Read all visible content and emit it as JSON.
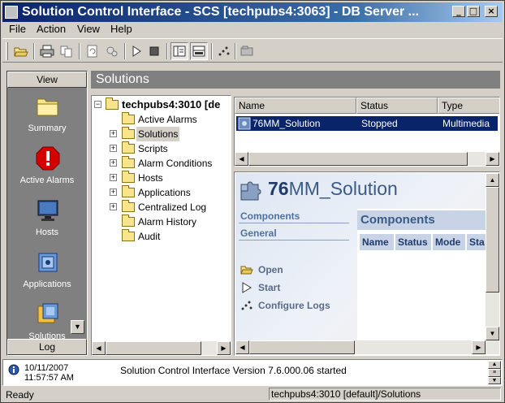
{
  "window": {
    "title": "Solution Control Interface - SCS [techpubs4:3063] - DB Server ...",
    "min_glyph": "_",
    "max_glyph": "□",
    "close_glyph": "×"
  },
  "menu": [
    "File",
    "Action",
    "View",
    "Help"
  ],
  "toolbar": {
    "icons": [
      "open-folder-icon",
      "print-icon",
      "copy-icon",
      "refresh-icon",
      "properties-icon",
      "start-icon",
      "stop-icon",
      "view-tree-icon",
      "view-details-icon",
      "configure-logs-icon",
      "database-icon"
    ]
  },
  "viewbar": {
    "header": "View",
    "footer": "Log",
    "items": [
      {
        "label": "Summary",
        "icon": "folder-icon"
      },
      {
        "label": "Active Alarms",
        "icon": "alarm-icon"
      },
      {
        "label": "Hosts",
        "icon": "monitor-icon"
      },
      {
        "label": "Applications",
        "icon": "application-icon"
      },
      {
        "label": "Solutions",
        "icon": "solution-icon"
      }
    ]
  },
  "section_title": "Solutions",
  "tree": {
    "root": "techpubs4:3010 [de",
    "items": [
      {
        "label": "Active Alarms",
        "expandable": false,
        "selected": false
      },
      {
        "label": "Solutions",
        "expandable": true,
        "selected": true
      },
      {
        "label": "Scripts",
        "expandable": true,
        "selected": false
      },
      {
        "label": "Alarm Conditions",
        "expandable": true,
        "selected": false
      },
      {
        "label": "Hosts",
        "expandable": true,
        "selected": false
      },
      {
        "label": "Applications",
        "expandable": true,
        "selected": false
      },
      {
        "label": "Centralized Log",
        "expandable": true,
        "selected": false
      },
      {
        "label": "Alarm History",
        "expandable": false,
        "selected": false
      },
      {
        "label": "Audit",
        "expandable": false,
        "selected": false
      }
    ]
  },
  "list": {
    "columns": [
      "Name",
      "Status",
      "Type"
    ],
    "rows": [
      {
        "name": "76MM_Solution",
        "status": "Stopped",
        "type": "Multimedia"
      }
    ]
  },
  "detail": {
    "title_prefix": "76",
    "title_rest": "MM_Solution",
    "links": [
      "Components",
      "General"
    ],
    "components_header": "Components",
    "components_columns": [
      "Name",
      "Status",
      "Mode",
      "Sta"
    ],
    "actions": [
      {
        "label": "Open",
        "icon": "open-folder-icon"
      },
      {
        "label": "Start",
        "icon": "start-icon"
      },
      {
        "label": "Configure Logs",
        "icon": "configure-logs-icon"
      }
    ]
  },
  "log": {
    "date": "10/11/2007",
    "time": "11:57:57 AM",
    "message": "Solution Control Interface Version 7.6.000.06 started"
  },
  "status": {
    "left": "Ready",
    "right": "techpubs4:3010 [default]/Solutions"
  },
  "colors": {
    "selection": "#0a246a",
    "panel_gray": "#808080",
    "detail_blue": "#3a5a88"
  }
}
